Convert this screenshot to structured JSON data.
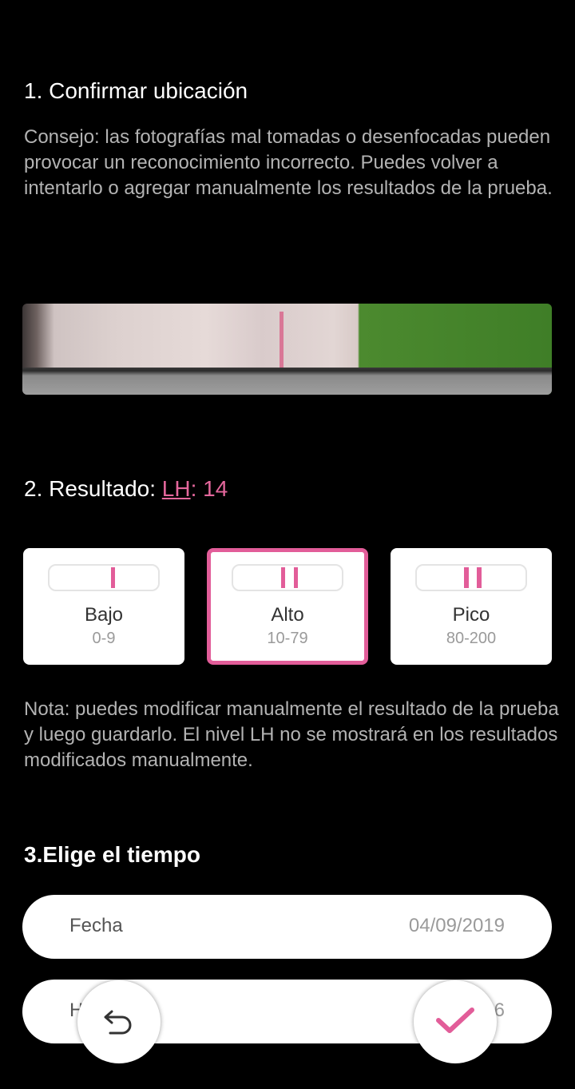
{
  "step1": {
    "title": "1. Confirmar ubicación",
    "tip": "Consejo: las fotografías mal tomadas o desenfocadas pueden provocar un reconocimiento incorrecto. Puedes volver a intentarlo o agregar manualmente los resultados de la prueba."
  },
  "step2": {
    "title_prefix": "2. Resultado: ",
    "lh_link": "LH",
    "lh_value": ": 14",
    "options": [
      {
        "label": "Bajo",
        "range": "0-9"
      },
      {
        "label": "Alto",
        "range": "10-79"
      },
      {
        "label": "Pico",
        "range": "80-200"
      }
    ],
    "selected": "Alto",
    "note": "Nota: puedes modificar manualmente el resultado de la prueba y luego guardarlo. El nivel LH no se mostrará en los resultados modificados manualmente."
  },
  "step3": {
    "title": "3.Elige el tiempo",
    "date_label": "Fecha",
    "date_value": "04/09/2019",
    "time_label_partial": "H",
    "time_value_partial": "6"
  },
  "colors": {
    "accent": "#e25d99",
    "background": "#000000"
  },
  "icons": {
    "undo": "undo-icon",
    "confirm": "check-icon"
  }
}
